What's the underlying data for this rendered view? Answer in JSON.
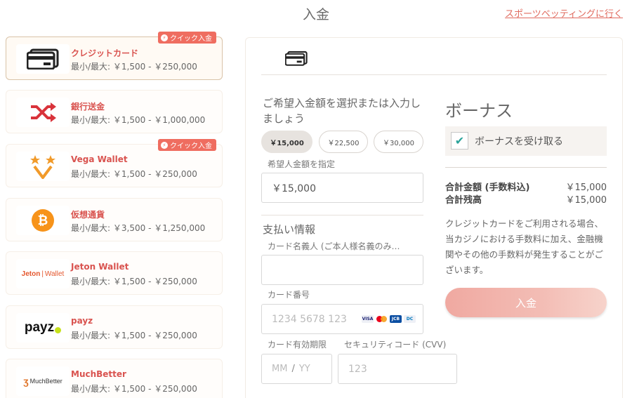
{
  "header": {
    "title": "入金",
    "sports_link": "スポーツベッティングに行く"
  },
  "methods": [
    {
      "name": "クレジットカード",
      "range": "最小/最大: ￥1,500 - ￥250,000",
      "quick": true,
      "selected": true,
      "icon": "credit-card-icon"
    },
    {
      "name": "銀行送金",
      "range": "最小/最大: ￥1,500 - ￥1,000,000",
      "quick": false,
      "icon": "shuffle-icon"
    },
    {
      "name": "Vega Wallet",
      "range": "最小/最大: ￥1,500 - ￥250,000",
      "quick": true,
      "icon": "vega-wallet-logo"
    },
    {
      "name": "仮想通貨",
      "range": "最小/最大: ￥3,500 - ￥1,250,000",
      "quick": false,
      "icon": "bitcoin-icon"
    },
    {
      "name": "Jeton Wallet",
      "range": "最小/最大: ￥1,500 - ￥250,000",
      "quick": false,
      "icon": "jeton-logo",
      "logo_text_a": "Jeton",
      "logo_text_b": "Wallet"
    },
    {
      "name": "payz",
      "range": "最小/最大: ￥1,500 - ￥250,000",
      "quick": false,
      "icon": "payz-logo",
      "logo_text": "payz"
    },
    {
      "name": "MuchBetter",
      "range": "最小/最大: ￥1,500 - ￥250,000",
      "quick": false,
      "icon": "muchbetter-logo",
      "logo_text": "MuchBetter"
    }
  ],
  "quick_badge_label": "クイック入金",
  "form": {
    "amount_title": "ご希望入金額を選択または入力しましょう",
    "chips": [
      "￥15,000",
      "￥22,500",
      "￥30,000"
    ],
    "active_chip": 0,
    "custom_amount_label": "希望人金額を指定",
    "custom_amount_value": "￥15,000",
    "payment_info_title": "支払い情報",
    "cardholder_label": "カード名義人 (ご本人様名義のみ…",
    "cardholder_value": "",
    "card_number_label": "カード番号",
    "card_number_placeholder": "1234 5678 123",
    "card_brands": [
      "VISA",
      "MC",
      "JCB",
      "DC"
    ],
    "expiry_label": "カード有効期限",
    "expiry_mm": "MM",
    "expiry_sep": "/",
    "expiry_yy": "YY",
    "cvv_label": "セキュリティコード (CVV)",
    "cvv_placeholder": "123"
  },
  "bonus": {
    "title": "ボーナス",
    "checkbox_label": "ボーナスを受け取る",
    "checked": true,
    "total_label": "合計金額 (手数料込)",
    "total_value": "￥15,000",
    "balance_label": "合計残高",
    "balance_value": "￥15,000",
    "note": "クレジットカードをご利用される場合、当カジノにおける手数料に加え、金融機関やその他の手数料が発生することがございます。",
    "deposit_button": "入金"
  },
  "colors": {
    "accent": "#ef6d60",
    "method_name": "#d9534f",
    "bonus_check": "#2aa39a",
    "deposit_button": "#f0a9a1"
  }
}
